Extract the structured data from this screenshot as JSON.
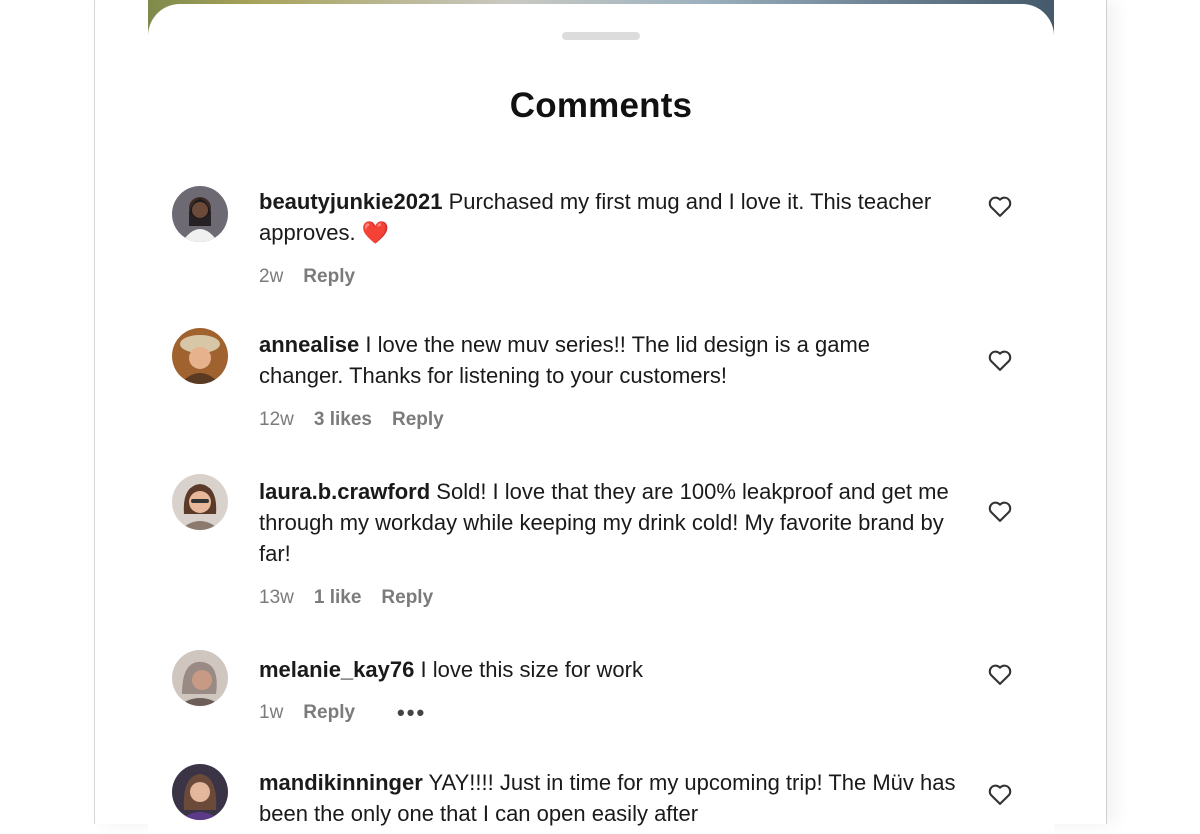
{
  "sheet": {
    "title": "Comments"
  },
  "comments": [
    {
      "username": "beautyjunkie2021",
      "text": "Purchased my first mug and I love it. This teacher approves.",
      "emoji": "❤️",
      "age": "2w",
      "likes": "",
      "reply": "Reply",
      "avatar_color": "#2d2a2e"
    },
    {
      "username": "annealise",
      "text": "I love the new muv series!! The lid design is a game changer. Thanks for listening to your customers!",
      "emoji": "",
      "age": "12w",
      "likes": "3 likes",
      "reply": "Reply",
      "avatar_color": "#b5753c"
    },
    {
      "username": "laura.b.crawford",
      "text": "Sold! I love that they are 100% leakproof and get me through my workday while keeping my drink cold! My favorite brand by far!",
      "emoji": "",
      "age": "13w",
      "likes": "1 like",
      "reply": "Reply",
      "avatar_color": "#8a6a58"
    },
    {
      "username": "melanie_kay76",
      "text": "I love this size for work",
      "emoji": "",
      "age": "1w",
      "likes": "",
      "reply": "Reply",
      "more": "•••",
      "avatar_color": "#9b8c86"
    },
    {
      "username": "mandikinninger",
      "text": "YAY!!!! Just in time for my upcoming trip! The Müv has been the only one that I can open easily after",
      "emoji": "",
      "age": "",
      "likes": "",
      "reply": "",
      "avatar_color": "#4a3a55"
    }
  ],
  "icons": {
    "like": "heart-outline-icon",
    "more": "more-dots-icon"
  }
}
